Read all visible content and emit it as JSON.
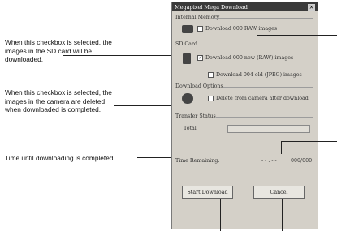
{
  "callouts": {
    "sd_checkbox": "When this checkbox is selected, the images in the SD card will be downloaded.",
    "delete_checkbox": "When this checkbox is selected, the images in the camera are deleted when downloaded is completed.",
    "time_until": "Time until downloading is completed"
  },
  "window": {
    "title": "Megapixel Mega Download",
    "close_glyph": "×",
    "internal_memory": {
      "label": "Internal Memory",
      "option": "Download 000 RAW images"
    },
    "sd_card": {
      "label": "SD Card",
      "option1": "Download 000 new (RAW) images",
      "option2": "Download 004 old (JPEG) images"
    },
    "download_options": {
      "label": "Download Options",
      "option": "Delete from camera after download"
    },
    "transfer_status": {
      "label": "Transfer Status",
      "total_label": "Total",
      "time_label": "Time Remaining:",
      "time_value": "- - : - -",
      "counter": "000/000"
    },
    "buttons": {
      "start": "Start Download",
      "cancel": "Cancel"
    }
  }
}
